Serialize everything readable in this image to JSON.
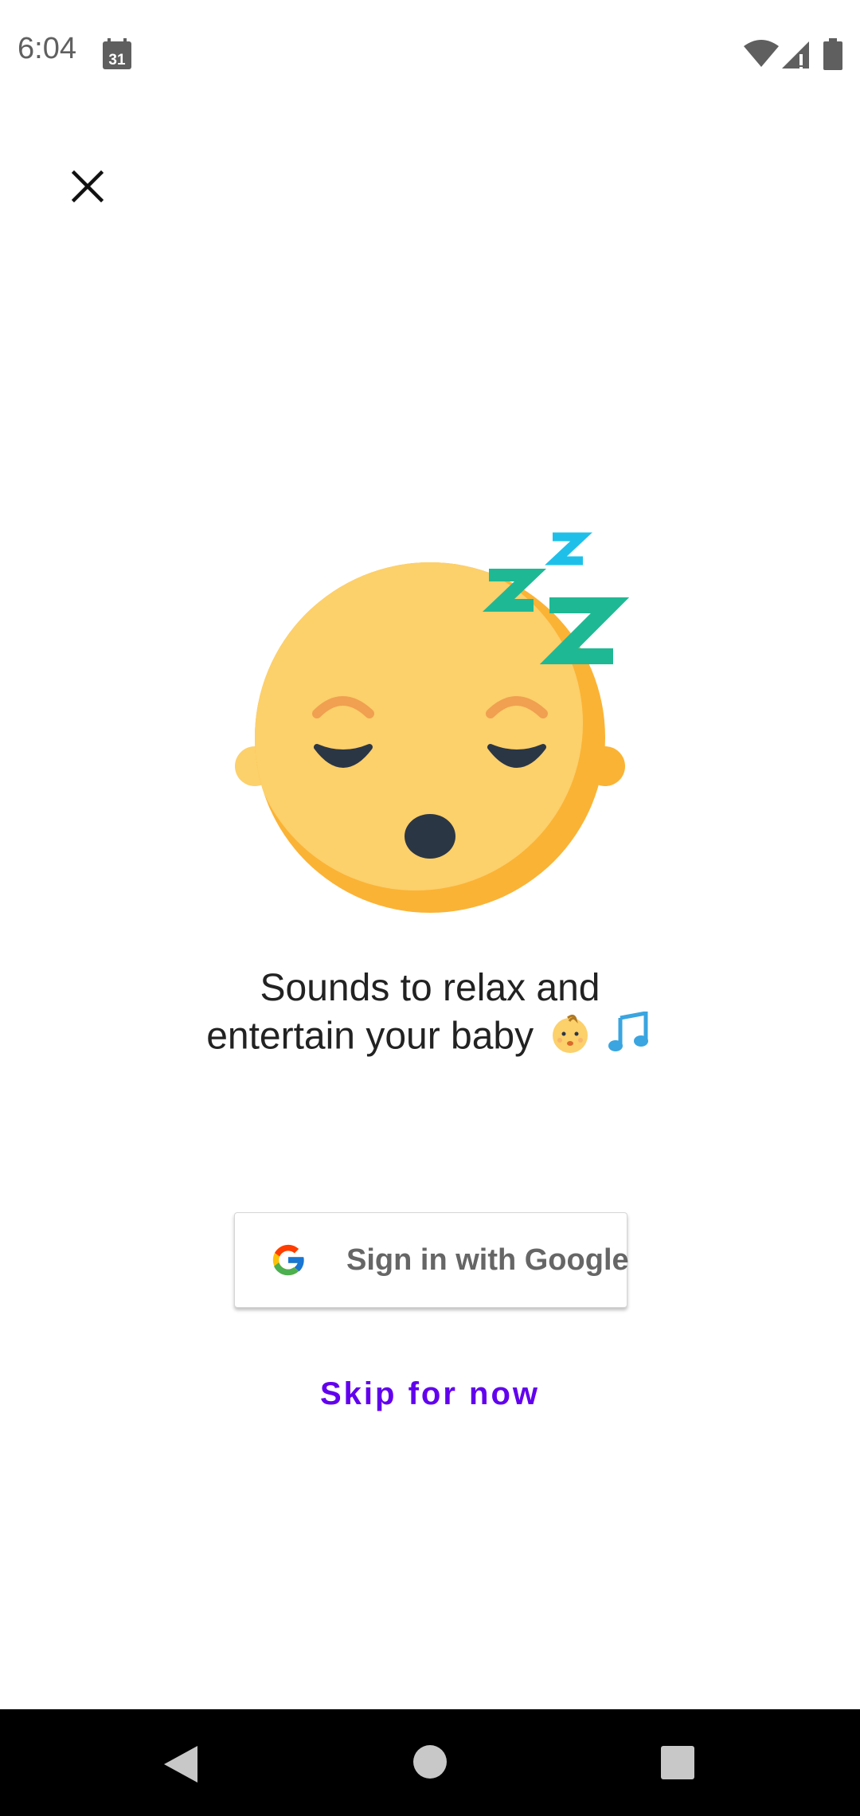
{
  "status_bar": {
    "time": "6:04",
    "calendar_day": "31",
    "icons": [
      "calendar-icon",
      "wifi-icon",
      "cell-signal-icon",
      "battery-icon"
    ]
  },
  "header": {
    "close_icon": "close-icon"
  },
  "illustration": {
    "icon": "sleeping-face-icon",
    "colors": {
      "face": "#fcd06b",
      "face_shadow": "#fbb335",
      "features": "#2b3645",
      "brows": "#f0a050",
      "z_primary": "#1fb894",
      "z_secondary": "#1ec0ea"
    }
  },
  "content": {
    "headline_line1": "Sounds to relax and",
    "headline_line2": "entertain your baby",
    "headline_emojis": [
      "baby-emoji-icon",
      "musical-notes-emoji-icon"
    ]
  },
  "actions": {
    "google_signin_label": "Sign in with Google",
    "skip_label": "Skip for now",
    "accent_color": "#6200ee"
  },
  "nav_bar": {
    "icons": [
      "back-icon",
      "home-icon",
      "recents-icon"
    ]
  }
}
